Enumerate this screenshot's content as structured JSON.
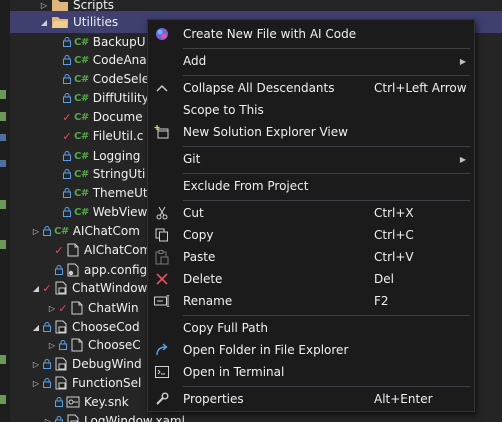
{
  "tree": {
    "rows": [
      {
        "label": "Scripts",
        "kind": "folder"
      },
      {
        "label": "Utilities",
        "kind": "folder"
      },
      {
        "label": "BackupU",
        "kind": "cs"
      },
      {
        "label": "CodeAna",
        "kind": "cs"
      },
      {
        "label": "CodeSele",
        "kind": "cs"
      },
      {
        "label": "DiffUtility",
        "kind": "cs"
      },
      {
        "label": "Docume",
        "kind": "cs"
      },
      {
        "label": "FileUtil.c",
        "kind": "cs"
      },
      {
        "label": "Logging",
        "kind": "cs"
      },
      {
        "label": "StringUti",
        "kind": "cs"
      },
      {
        "label": "ThemeUt",
        "kind": "cs"
      },
      {
        "label": "WebView",
        "kind": "cs"
      },
      {
        "label": "AIChatCom",
        "kind": "cs"
      },
      {
        "label": "AIChatCom",
        "kind": "file"
      },
      {
        "label": "app.config",
        "kind": "config"
      },
      {
        "label": "ChatWindow",
        "kind": "xaml"
      },
      {
        "label": "ChatWin",
        "kind": "file"
      },
      {
        "label": "ChooseCod",
        "kind": "xaml"
      },
      {
        "label": "ChooseC",
        "kind": "file"
      },
      {
        "label": "DebugWind",
        "kind": "xaml"
      },
      {
        "label": "FunctionSel",
        "kind": "xaml"
      },
      {
        "label": "Key.snk",
        "kind": "key"
      },
      {
        "label": "LogWindow.xaml",
        "kind": "xaml"
      }
    ]
  },
  "context_menu": {
    "items": [
      {
        "label": "Create New File with AI Code",
        "icon": "ai-sparkle-icon",
        "shortcut": ""
      },
      {
        "label": "Add",
        "icon": "",
        "shortcut": "",
        "submenu": true
      },
      {
        "label": "Collapse All Descendants",
        "icon": "collapse-icon",
        "shortcut": "Ctrl+Left Arrow"
      },
      {
        "label": "Scope to This",
        "icon": "",
        "shortcut": ""
      },
      {
        "label": "New Solution Explorer View",
        "icon": "new-view-icon",
        "shortcut": ""
      },
      {
        "label": "Git",
        "icon": "",
        "shortcut": "",
        "submenu": true
      },
      {
        "label": "Exclude From Project",
        "icon": "",
        "shortcut": ""
      },
      {
        "label": "Cut",
        "icon": "scissors-icon",
        "shortcut": "Ctrl+X"
      },
      {
        "label": "Copy",
        "icon": "copy-icon",
        "shortcut": "Ctrl+C"
      },
      {
        "label": "Paste",
        "icon": "paste-icon",
        "shortcut": "Ctrl+V"
      },
      {
        "label": "Delete",
        "icon": "delete-x-icon",
        "shortcut": "Del"
      },
      {
        "label": "Rename",
        "icon": "rename-icon",
        "shortcut": "F2"
      },
      {
        "label": "Copy Full Path",
        "icon": "",
        "shortcut": ""
      },
      {
        "label": "Open Folder in File Explorer",
        "icon": "open-folder-arrow-icon",
        "shortcut": ""
      },
      {
        "label": "Open in Terminal",
        "icon": "terminal-icon",
        "shortcut": ""
      },
      {
        "label": "Properties",
        "icon": "wrench-icon",
        "shortcut": "Alt+Enter"
      }
    ]
  },
  "colors": {
    "selection": "#3f3f70",
    "menu_bg": "#1b1b1c",
    "csharp": "#57a64a",
    "check": "#e04f5f"
  }
}
